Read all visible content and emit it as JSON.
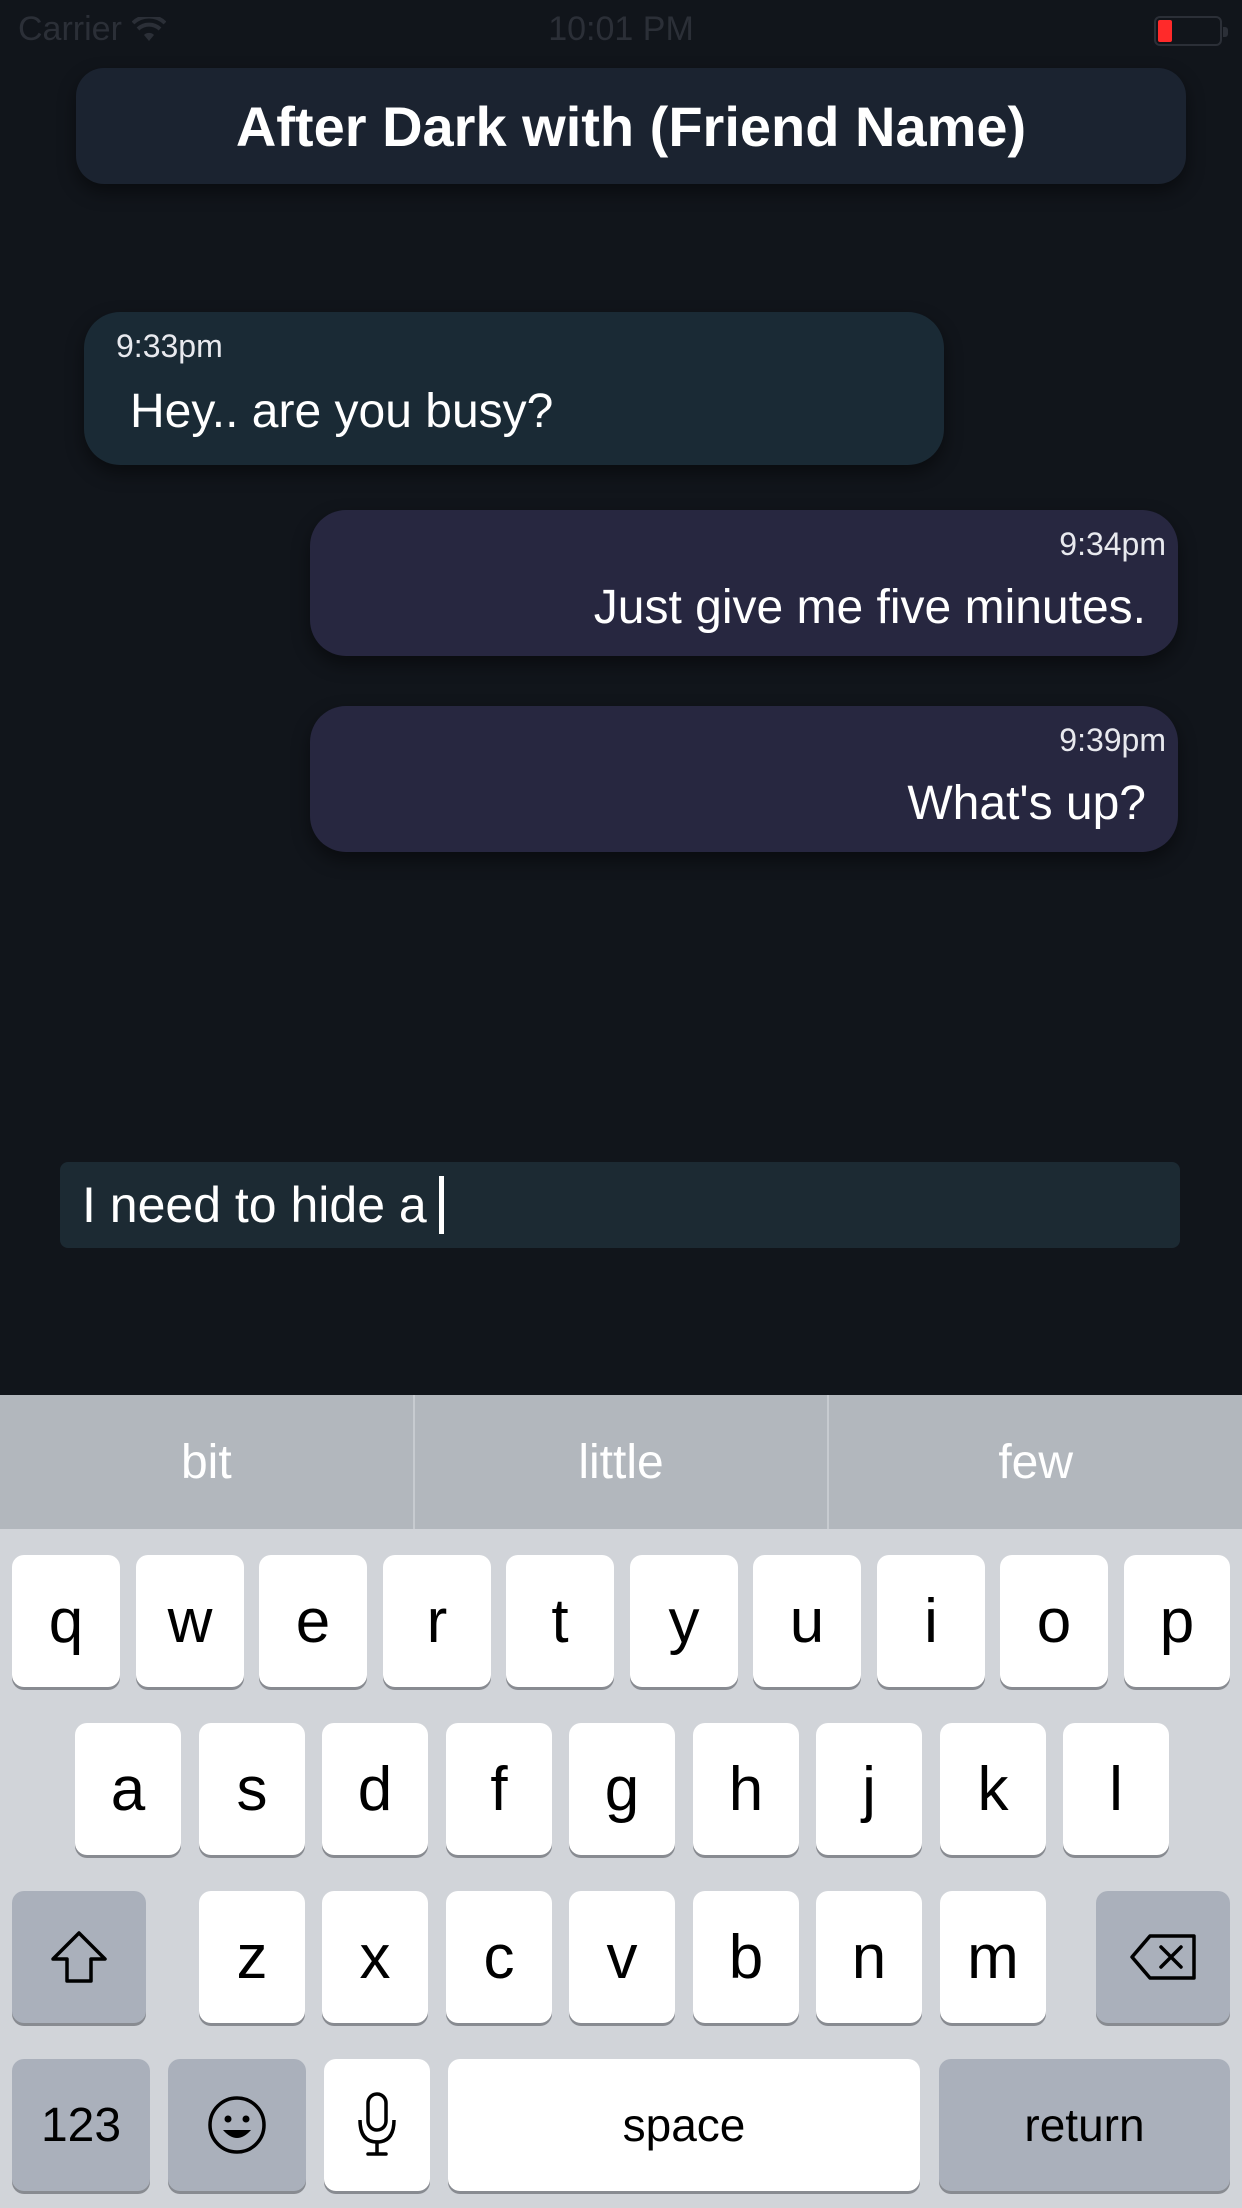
{
  "status_bar": {
    "carrier": "Carrier",
    "time": "10:01 PM"
  },
  "header": {
    "title": "After Dark with (Friend Name)"
  },
  "messages": [
    {
      "time": "9:33pm",
      "text": "Hey.. are you busy?"
    },
    {
      "time": "9:34pm",
      "text": "Just give me five minutes."
    },
    {
      "time": "9:39pm",
      "text": "What's up?"
    }
  ],
  "input": {
    "value": "I need to hide a"
  },
  "keyboard": {
    "suggestions": [
      "bit",
      "little",
      "few"
    ],
    "row1": [
      "q",
      "w",
      "e",
      "r",
      "t",
      "y",
      "u",
      "i",
      "o",
      "p"
    ],
    "row2": [
      "a",
      "s",
      "d",
      "f",
      "g",
      "h",
      "j",
      "k",
      "l"
    ],
    "row3": [
      "z",
      "x",
      "c",
      "v",
      "b",
      "n",
      "m"
    ],
    "numbers_label": "123",
    "space_label": "space",
    "return_label": "return"
  },
  "colors": {
    "background": "#11151b",
    "incoming_bubble": "#1a2a35",
    "outgoing_bubble": "#272740",
    "battery_low": "#ff2a2a"
  }
}
